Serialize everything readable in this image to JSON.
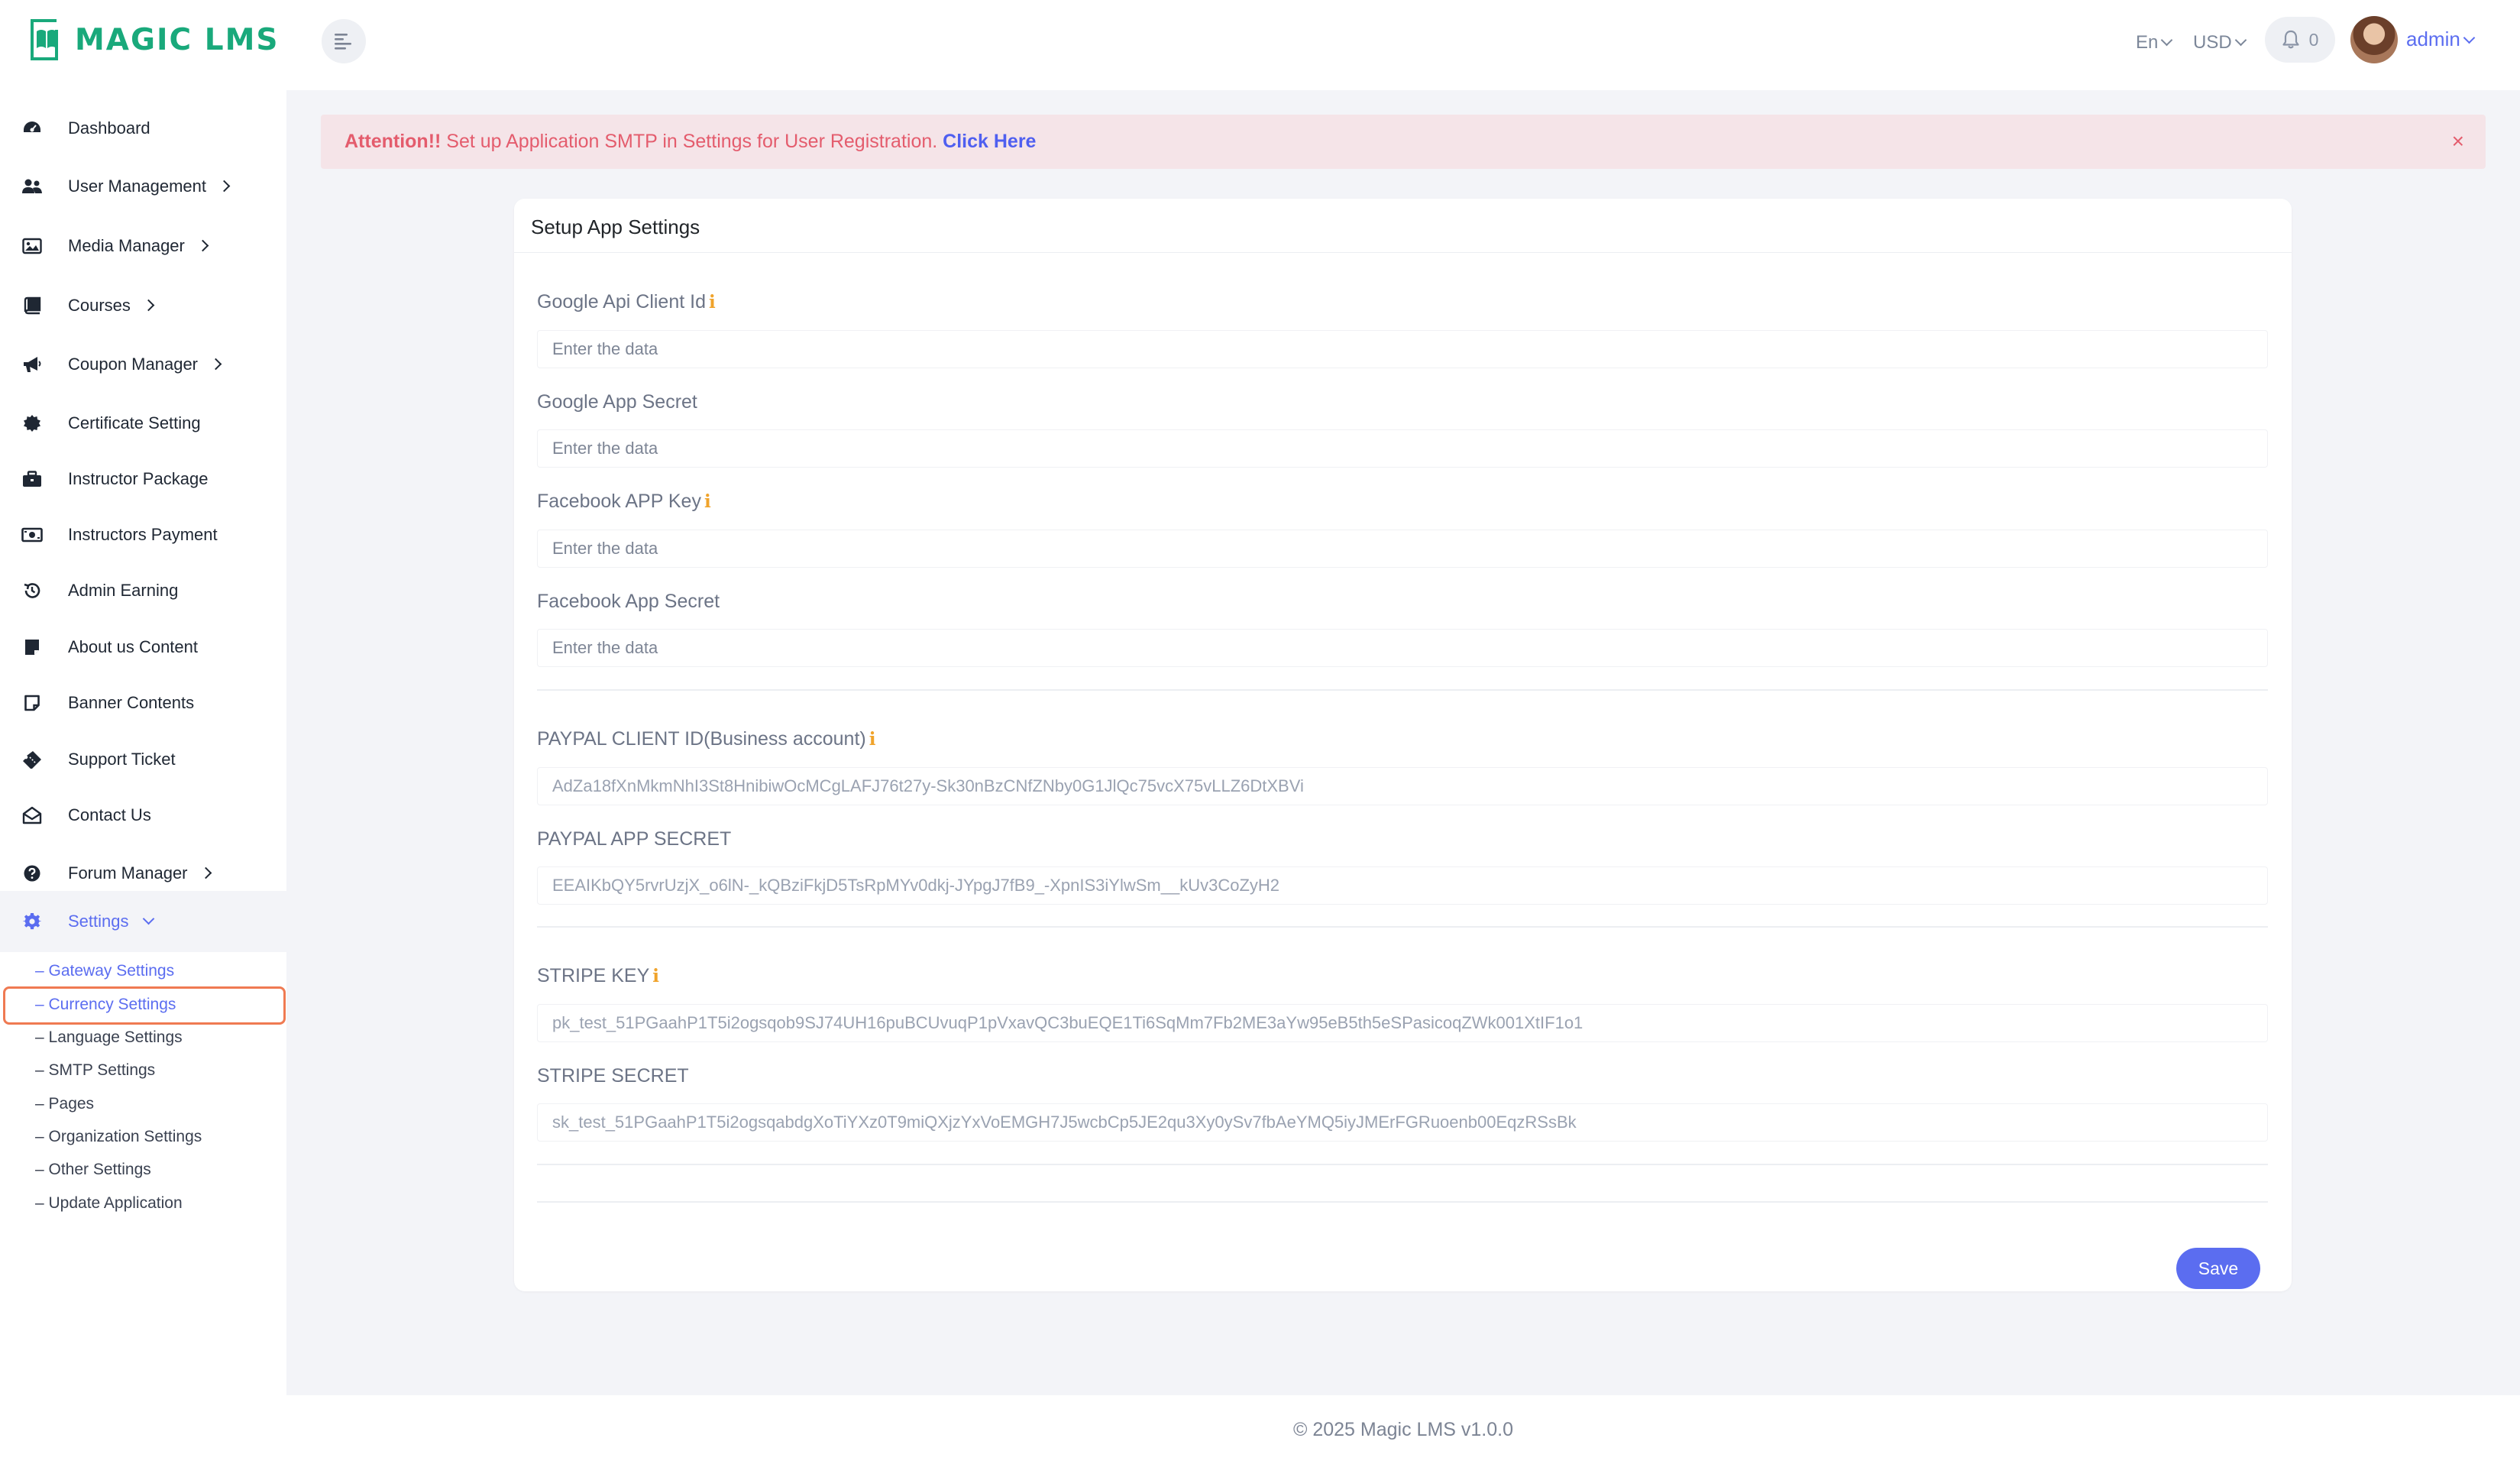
{
  "app": {
    "logo_text": "MAGIC LMS",
    "brand_color": "#19a97b",
    "accent_color": "#5b6df0"
  },
  "header": {
    "language": "En",
    "currency": "USD",
    "notifications_count": "0",
    "user_name": "admin"
  },
  "sidebar": {
    "items": [
      {
        "label": "Dashboard",
        "icon": "dashboard-icon"
      },
      {
        "label": "User Management",
        "icon": "users-icon"
      },
      {
        "label": "Media Manager",
        "icon": "image-icon"
      },
      {
        "label": "Courses",
        "icon": "book-icon"
      },
      {
        "label": "Coupon Manager",
        "icon": "megaphone-icon"
      },
      {
        "label": "Certificate Setting",
        "icon": "certificate-icon"
      },
      {
        "label": "Instructor Package",
        "icon": "briefcase-icon"
      },
      {
        "label": "Instructors Payment",
        "icon": "money-icon"
      },
      {
        "label": "Admin Earning",
        "icon": "history-icon"
      },
      {
        "label": "About us Content",
        "icon": "note-icon"
      },
      {
        "label": "Banner Contents",
        "icon": "sticky-note-icon"
      },
      {
        "label": "Support Ticket",
        "icon": "ticket-icon"
      },
      {
        "label": "Contact Us",
        "icon": "envelope-open-icon"
      },
      {
        "label": "Forum Manager",
        "icon": "question-icon"
      },
      {
        "label": "Settings",
        "icon": "gear-icon"
      }
    ],
    "settings_sub": [
      "– Gateway Settings",
      "– Currency Settings",
      "– Language Settings",
      "– SMTP Settings",
      "– Pages",
      "– Organization Settings",
      "– Other Settings",
      "– Update Application"
    ]
  },
  "alert": {
    "prefix": "Attention!!",
    "message": " Set up Application SMTP in Settings for User Registration. ",
    "link": "Click Here",
    "close": "×"
  },
  "form": {
    "title": "Setup App Settings",
    "placeholder": "Enter the data",
    "info_mark": "i",
    "google_client_id_label": "Google Api Client Id",
    "google_secret_label": "Google App Secret",
    "facebook_key_label": "Facebook APP Key",
    "facebook_secret_label": "Facebook App Secret",
    "paypal_client_label": "PAYPAL CLIENT ID(Business account)",
    "paypal_client_value": "AdZa18fXnMkmNhI3St8HnibiwOcMCgLAFJ76t27y-Sk30nBzCNfZNby0G1JlQc75vcX75vLLZ6DtXBVi",
    "paypal_secret_label": "PAYPAL APP SECRET",
    "paypal_secret_value": "EEAIKbQY5rvrUzjX_o6lN-_kQBziFkjD5TsRpMYv0dkj-JYpgJ7fB9_-XpnIS3iYlwSm__kUv3CoZyH2",
    "stripe_key_label": "STRIPE KEY",
    "stripe_key_value": "pk_test_51PGaahP1T5i2ogsqob9SJ74UH16puBCUvuqP1pVxavQC3buEQE1Ti6SqMm7Fb2ME3aYw95eB5th5eSPasicoqZWk001XtIF1o1",
    "stripe_secret_label": "STRIPE SECRET",
    "stripe_secret_value": "sk_test_51PGaahP1T5i2ogsqabdgXoTiYXz0T9miQXjzYxVoEMGH7J5wcbCp5JE2qu3Xy0ySv7fbAeYMQ5iyJMErFGRuoenb00EqzRSsBk",
    "save_label": "Save"
  },
  "footer": {
    "text": "© 2025 Magic LMS v1.0.0"
  }
}
